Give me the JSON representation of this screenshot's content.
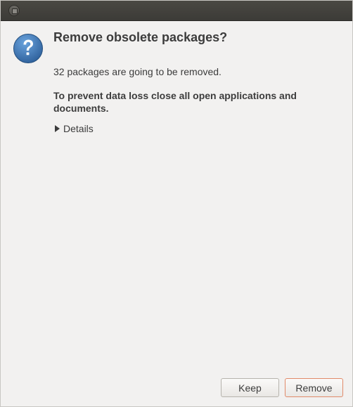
{
  "dialog": {
    "title": "Remove obsolete packages?",
    "message": "32 packages are going to be removed.",
    "warning": "To prevent data loss close all open applications and documents.",
    "details_label": "Details",
    "icon": "question-icon"
  },
  "buttons": {
    "keep_label": "Keep",
    "remove_label": "Remove"
  },
  "colors": {
    "icon_blue": "#3f77b5",
    "default_button_border": "#e18a6a",
    "titlebar": "#3c3b37"
  }
}
